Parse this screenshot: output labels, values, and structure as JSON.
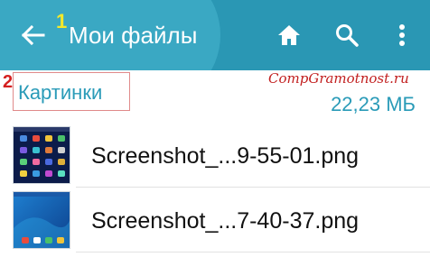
{
  "appbar": {
    "title": "Мои файлы",
    "annotation": "1",
    "icons": [
      "back-arrow-icon",
      "home-icon",
      "search-icon",
      "more-vert-icon"
    ],
    "bg_color": "#2a97b4",
    "title_color": "#ffffff"
  },
  "folder": {
    "annotation": "2",
    "name": "Картинки",
    "size": "22,23 МБ",
    "accent_color": "#2a9bb8"
  },
  "watermark": "CompGramotnost.ru",
  "files": [
    {
      "name": "Screenshot_...9-55-01.png",
      "thumbnail": "app-grid-screenshot"
    },
    {
      "name": "Screenshot_...7-40-37.png",
      "thumbnail": "blue-wallpaper-screenshot"
    }
  ]
}
